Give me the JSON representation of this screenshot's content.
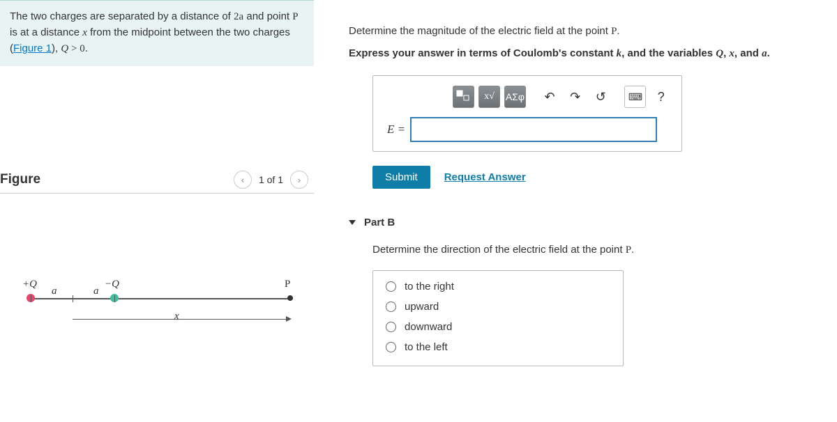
{
  "problem": {
    "text_prefix": "The two charges are separated by a distance of ",
    "dist": "2a",
    "text_mid1": " and point ",
    "pointP": "P",
    "text_mid2": " is at a distance ",
    "varx": "x",
    "text_mid3": " from the midpoint between the two charges (",
    "figlink": "Figure 1",
    "text_mid4": "), ",
    "cond_lhs": "Q",
    "cond_op": " > ",
    "cond_rhs": "0",
    "text_end": "."
  },
  "figure": {
    "title": "Figure",
    "nav": "1 of 1",
    "labels": {
      "plusQ": "+Q",
      "minusQ": "−Q",
      "P": "P",
      "a": "a",
      "x": "x"
    }
  },
  "partA": {
    "prompt1_pre": "Determine the magnitude of the electric field at the point ",
    "prompt1_P": "P",
    "prompt1_post": ".",
    "prompt2_pre": "Express your answer in terms of Coulomb's constant ",
    "k": "k",
    "prompt2_mid": ", and the variables ",
    "Q": "Q",
    "comma1": ", ",
    "x": "x",
    "comma2": ", and ",
    "a": "a",
    "prompt2_post": ".",
    "eq_label": "E =",
    "toolbar": {
      "templates": "▭",
      "sqrt": "√",
      "greek": "ΑΣφ",
      "undo": "↶",
      "redo": "↷",
      "reset": "↺",
      "keyboard": "⌨",
      "help": "?"
    },
    "submit": "Submit",
    "request": "Request Answer"
  },
  "partB": {
    "title": "Part B",
    "prompt_pre": "Determine the direction of the electric field at the point ",
    "prompt_P": "P",
    "prompt_post": ".",
    "options": [
      "to the right",
      "upward",
      "downward",
      "to the left"
    ]
  }
}
